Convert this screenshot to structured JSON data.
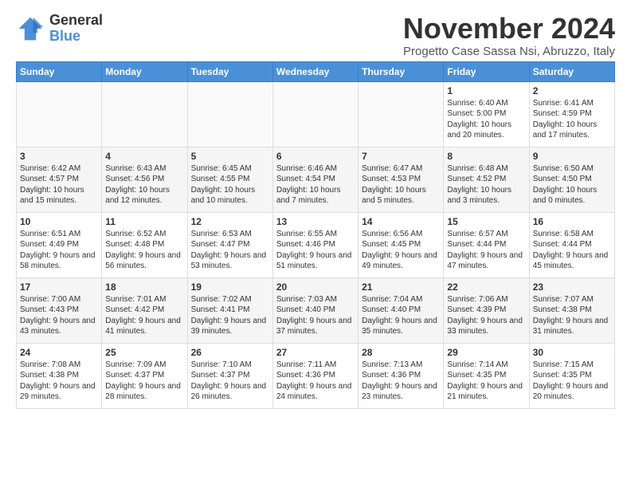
{
  "logo": {
    "general": "General",
    "blue": "Blue"
  },
  "header": {
    "month": "November 2024",
    "location": "Progetto Case Sassa Nsi, Abruzzo, Italy"
  },
  "days_of_week": [
    "Sunday",
    "Monday",
    "Tuesday",
    "Wednesday",
    "Thursday",
    "Friday",
    "Saturday"
  ],
  "weeks": [
    {
      "days": [
        {
          "num": "",
          "info": ""
        },
        {
          "num": "",
          "info": ""
        },
        {
          "num": "",
          "info": ""
        },
        {
          "num": "",
          "info": ""
        },
        {
          "num": "",
          "info": ""
        },
        {
          "num": "1",
          "info": "Sunrise: 6:40 AM\nSunset: 5:00 PM\nDaylight: 10 hours\nand 20 minutes."
        },
        {
          "num": "2",
          "info": "Sunrise: 6:41 AM\nSunset: 4:59 PM\nDaylight: 10 hours\nand 17 minutes."
        }
      ]
    },
    {
      "days": [
        {
          "num": "3",
          "info": "Sunrise: 6:42 AM\nSunset: 4:57 PM\nDaylight: 10 hours\nand 15 minutes."
        },
        {
          "num": "4",
          "info": "Sunrise: 6:43 AM\nSunset: 4:56 PM\nDaylight: 10 hours\nand 12 minutes."
        },
        {
          "num": "5",
          "info": "Sunrise: 6:45 AM\nSunset: 4:55 PM\nDaylight: 10 hours\nand 10 minutes."
        },
        {
          "num": "6",
          "info": "Sunrise: 6:46 AM\nSunset: 4:54 PM\nDaylight: 10 hours\nand 7 minutes."
        },
        {
          "num": "7",
          "info": "Sunrise: 6:47 AM\nSunset: 4:53 PM\nDaylight: 10 hours\nand 5 minutes."
        },
        {
          "num": "8",
          "info": "Sunrise: 6:48 AM\nSunset: 4:52 PM\nDaylight: 10 hours\nand 3 minutes."
        },
        {
          "num": "9",
          "info": "Sunrise: 6:50 AM\nSunset: 4:50 PM\nDaylight: 10 hours\nand 0 minutes."
        }
      ]
    },
    {
      "days": [
        {
          "num": "10",
          "info": "Sunrise: 6:51 AM\nSunset: 4:49 PM\nDaylight: 9 hours\nand 58 minutes."
        },
        {
          "num": "11",
          "info": "Sunrise: 6:52 AM\nSunset: 4:48 PM\nDaylight: 9 hours\nand 56 minutes."
        },
        {
          "num": "12",
          "info": "Sunrise: 6:53 AM\nSunset: 4:47 PM\nDaylight: 9 hours\nand 53 minutes."
        },
        {
          "num": "13",
          "info": "Sunrise: 6:55 AM\nSunset: 4:46 PM\nDaylight: 9 hours\nand 51 minutes."
        },
        {
          "num": "14",
          "info": "Sunrise: 6:56 AM\nSunset: 4:45 PM\nDaylight: 9 hours\nand 49 minutes."
        },
        {
          "num": "15",
          "info": "Sunrise: 6:57 AM\nSunset: 4:44 PM\nDaylight: 9 hours\nand 47 minutes."
        },
        {
          "num": "16",
          "info": "Sunrise: 6:58 AM\nSunset: 4:44 PM\nDaylight: 9 hours\nand 45 minutes."
        }
      ]
    },
    {
      "days": [
        {
          "num": "17",
          "info": "Sunrise: 7:00 AM\nSunset: 4:43 PM\nDaylight: 9 hours\nand 43 minutes."
        },
        {
          "num": "18",
          "info": "Sunrise: 7:01 AM\nSunset: 4:42 PM\nDaylight: 9 hours\nand 41 minutes."
        },
        {
          "num": "19",
          "info": "Sunrise: 7:02 AM\nSunset: 4:41 PM\nDaylight: 9 hours\nand 39 minutes."
        },
        {
          "num": "20",
          "info": "Sunrise: 7:03 AM\nSunset: 4:40 PM\nDaylight: 9 hours\nand 37 minutes."
        },
        {
          "num": "21",
          "info": "Sunrise: 7:04 AM\nSunset: 4:40 PM\nDaylight: 9 hours\nand 35 minutes."
        },
        {
          "num": "22",
          "info": "Sunrise: 7:06 AM\nSunset: 4:39 PM\nDaylight: 9 hours\nand 33 minutes."
        },
        {
          "num": "23",
          "info": "Sunrise: 7:07 AM\nSunset: 4:38 PM\nDaylight: 9 hours\nand 31 minutes."
        }
      ]
    },
    {
      "days": [
        {
          "num": "24",
          "info": "Sunrise: 7:08 AM\nSunset: 4:38 PM\nDaylight: 9 hours\nand 29 minutes."
        },
        {
          "num": "25",
          "info": "Sunrise: 7:09 AM\nSunset: 4:37 PM\nDaylight: 9 hours\nand 28 minutes."
        },
        {
          "num": "26",
          "info": "Sunrise: 7:10 AM\nSunset: 4:37 PM\nDaylight: 9 hours\nand 26 minutes."
        },
        {
          "num": "27",
          "info": "Sunrise: 7:11 AM\nSunset: 4:36 PM\nDaylight: 9 hours\nand 24 minutes."
        },
        {
          "num": "28",
          "info": "Sunrise: 7:13 AM\nSunset: 4:36 PM\nDaylight: 9 hours\nand 23 minutes."
        },
        {
          "num": "29",
          "info": "Sunrise: 7:14 AM\nSunset: 4:35 PM\nDaylight: 9 hours\nand 21 minutes."
        },
        {
          "num": "30",
          "info": "Sunrise: 7:15 AM\nSunset: 4:35 PM\nDaylight: 9 hours\nand 20 minutes."
        }
      ]
    }
  ]
}
